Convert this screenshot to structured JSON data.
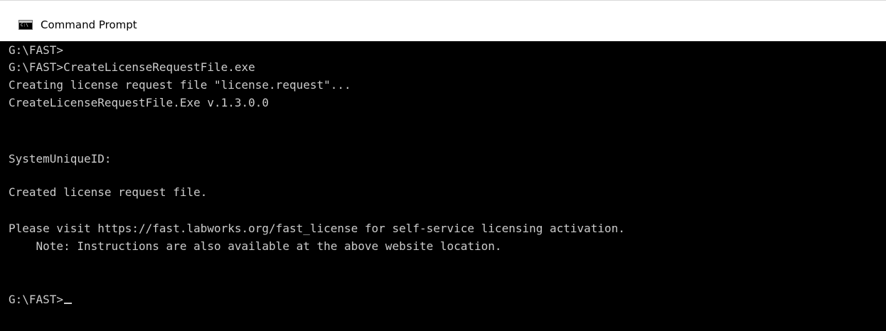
{
  "window": {
    "title": "Command Prompt",
    "icon": "console-icon",
    "icon_text": "C:\\"
  },
  "console": {
    "lines": [
      "G:\\FAST>",
      "G:\\FAST>CreateLicenseRequestFile.exe",
      "Creating license request file \"license.request\"...",
      "CreateLicenseRequestFile.Exe v.1.3.0.0",
      "SystemUniqueID:",
      "Created license request file.",
      "Please visit https://fast.labworks.org/fast_license for self-service licensing activation.",
      "    Note: Instructions are also available at the above website location."
    ],
    "prompt": "G:\\FAST>"
  },
  "colors": {
    "background": "#000000",
    "text": "#cccccc",
    "titlebar": "#ffffff"
  }
}
